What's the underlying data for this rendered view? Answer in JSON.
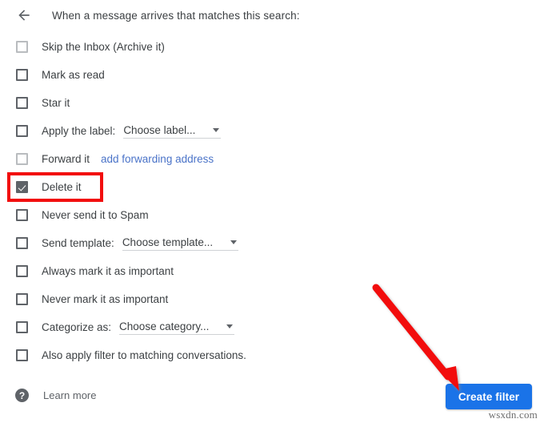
{
  "header": {
    "back_icon": "back-arrow-icon",
    "title": "When a message arrives that matches this search:"
  },
  "options": [
    {
      "label": "Skip the Inbox (Archive it)",
      "checked": false,
      "style": "light"
    },
    {
      "label": "Mark as read",
      "checked": false,
      "style": "normal"
    },
    {
      "label": "Star it",
      "checked": false,
      "style": "normal"
    },
    {
      "label": "Apply the label:",
      "checked": false,
      "style": "normal",
      "select": "Choose label..."
    },
    {
      "label": "Forward it",
      "checked": false,
      "style": "light",
      "link": "add forwarding address"
    },
    {
      "label": "Delete it",
      "checked": true,
      "style": "normal",
      "highlighted": true
    },
    {
      "label": "Never send it to Spam",
      "checked": false,
      "style": "normal"
    },
    {
      "label": "Send template:",
      "checked": false,
      "style": "normal",
      "select": "Choose template..."
    },
    {
      "label": "Always mark it as important",
      "checked": false,
      "style": "normal"
    },
    {
      "label": "Never mark it as important",
      "checked": false,
      "style": "normal"
    },
    {
      "label": "Categorize as:",
      "checked": false,
      "style": "normal",
      "select": "Choose category..."
    },
    {
      "label": "Also apply filter to matching conversations.",
      "checked": false,
      "style": "normal"
    }
  ],
  "footer": {
    "help_icon": "question-mark-icon",
    "learn_more_label": "Learn more",
    "create_filter_label": "Create filter"
  },
  "annotation": {
    "highlight_color": "#f20d0d",
    "arrow_color": "#f20d0d",
    "arrow_start": "468,357",
    "arrow_end": "572,486"
  },
  "watermark": "wsxdn.com",
  "colors": {
    "accent_blue": "#1a73e8",
    "link_blue": "#4a73c8",
    "text": "#3c4043",
    "muted": "#5f6368"
  }
}
